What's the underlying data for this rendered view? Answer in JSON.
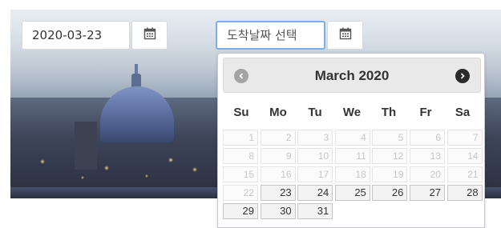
{
  "start_date": {
    "value": "2020-03-23"
  },
  "end_date": {
    "placeholder": "도착날짜 선택"
  },
  "icons": {
    "calendar": "calendar-icon",
    "prev": "chevron-left-circle-icon",
    "next": "chevron-right-circle-icon"
  },
  "datepicker": {
    "title": "March 2020",
    "weekdays": [
      "Su",
      "Mo",
      "Tu",
      "We",
      "Th",
      "Fr",
      "Sa"
    ],
    "leading_blanks": 0,
    "days": [
      {
        "d": "1",
        "enabled": false
      },
      {
        "d": "2",
        "enabled": false
      },
      {
        "d": "3",
        "enabled": false
      },
      {
        "d": "4",
        "enabled": false
      },
      {
        "d": "5",
        "enabled": false
      },
      {
        "d": "6",
        "enabled": false
      },
      {
        "d": "7",
        "enabled": false
      },
      {
        "d": "8",
        "enabled": false
      },
      {
        "d": "9",
        "enabled": false
      },
      {
        "d": "10",
        "enabled": false
      },
      {
        "d": "11",
        "enabled": false
      },
      {
        "d": "12",
        "enabled": false
      },
      {
        "d": "13",
        "enabled": false
      },
      {
        "d": "14",
        "enabled": false
      },
      {
        "d": "15",
        "enabled": false
      },
      {
        "d": "16",
        "enabled": false
      },
      {
        "d": "17",
        "enabled": false
      },
      {
        "d": "18",
        "enabled": false
      },
      {
        "d": "19",
        "enabled": false
      },
      {
        "d": "20",
        "enabled": false
      },
      {
        "d": "21",
        "enabled": false
      },
      {
        "d": "22",
        "enabled": false
      },
      {
        "d": "23",
        "enabled": true
      },
      {
        "d": "24",
        "enabled": true
      },
      {
        "d": "25",
        "enabled": true
      },
      {
        "d": "26",
        "enabled": true
      },
      {
        "d": "27",
        "enabled": true
      },
      {
        "d": "28",
        "enabled": true
      },
      {
        "d": "29",
        "enabled": true
      },
      {
        "d": "30",
        "enabled": true
      },
      {
        "d": "31",
        "enabled": true
      }
    ]
  },
  "colors": {
    "active_border": "#7faee6",
    "header_bg": "#e9e9ea",
    "disabled_text": "#c6c6c6",
    "enabled_text": "#333333"
  }
}
